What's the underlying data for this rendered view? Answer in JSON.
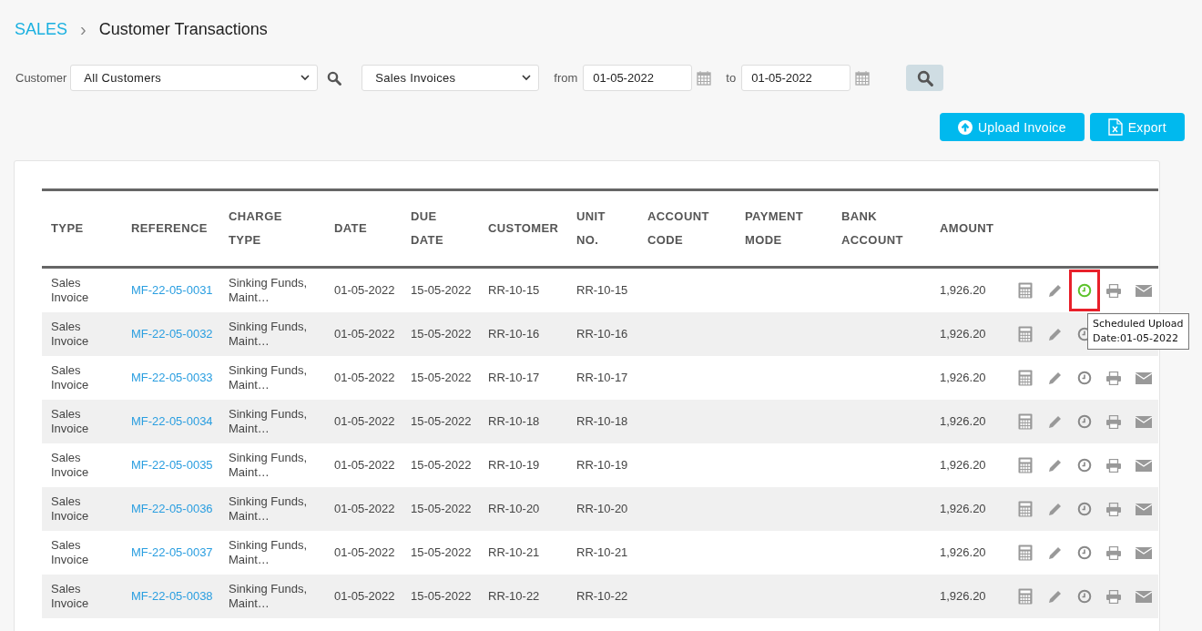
{
  "breadcrumb": {
    "section": "SALES",
    "separator": "›",
    "page": "Customer Transactions"
  },
  "filters": {
    "customer_label": "Customer",
    "customer": "All Customers",
    "doc_type": "Sales Invoices",
    "from_label": "from",
    "from": "01-05-2022",
    "to_label": "to",
    "to": "01-05-2022"
  },
  "buttons": [
    {
      "label": "Upload Invoice",
      "kind": "upload"
    },
    {
      "label": "Export",
      "kind": "export"
    }
  ],
  "table": {
    "columns": [
      [
        "TYPE"
      ],
      [
        "REFERENCE"
      ],
      [
        "CHARGE",
        "TYPE"
      ],
      [
        "DATE"
      ],
      [
        "DUE",
        "DATE"
      ],
      [
        "CUSTOMER"
      ],
      [
        "UNIT",
        "NO."
      ],
      [
        "ACCOUNT",
        "CODE"
      ],
      [
        "PAYMENT",
        "MODE"
      ],
      [
        "BANK",
        "ACCOUNT"
      ],
      [
        "AMOUNT"
      ]
    ],
    "rows": [
      {
        "type": [
          "Sales",
          "Invoice"
        ],
        "reference": "MF-22-05-0031",
        "charge": [
          "Sinking Funds,",
          "Maint…"
        ],
        "date": "01-05-2022",
        "due": "15-05-2022",
        "customer": "RR-10-15",
        "unit": "RR-10-15",
        "amount": "1,926.20",
        "scheduled": true,
        "highlighted": true,
        "tooltip": [
          "Scheduled Upload",
          "Date:01-05-2022"
        ]
      },
      {
        "type": [
          "Sales",
          "Invoice"
        ],
        "reference": "MF-22-05-0032",
        "charge": [
          "Sinking Funds,",
          "Maint…"
        ],
        "date": "01-05-2022",
        "due": "15-05-2022",
        "customer": "RR-10-16",
        "unit": "RR-10-16",
        "amount": "1,926.20",
        "scheduled": false,
        "highlighted": false
      },
      {
        "type": [
          "Sales",
          "Invoice"
        ],
        "reference": "MF-22-05-0033",
        "charge": [
          "Sinking Funds,",
          "Maint…"
        ],
        "date": "01-05-2022",
        "due": "15-05-2022",
        "customer": "RR-10-17",
        "unit": "RR-10-17",
        "amount": "1,926.20",
        "scheduled": false,
        "highlighted": false
      },
      {
        "type": [
          "Sales",
          "Invoice"
        ],
        "reference": "MF-22-05-0034",
        "charge": [
          "Sinking Funds,",
          "Maint…"
        ],
        "date": "01-05-2022",
        "due": "15-05-2022",
        "customer": "RR-10-18",
        "unit": "RR-10-18",
        "amount": "1,926.20",
        "scheduled": false,
        "highlighted": false
      },
      {
        "type": [
          "Sales",
          "Invoice"
        ],
        "reference": "MF-22-05-0035",
        "charge": [
          "Sinking Funds,",
          "Maint…"
        ],
        "date": "01-05-2022",
        "due": "15-05-2022",
        "customer": "RR-10-19",
        "unit": "RR-10-19",
        "amount": "1,926.20",
        "scheduled": false,
        "highlighted": false
      },
      {
        "type": [
          "Sales",
          "Invoice"
        ],
        "reference": "MF-22-05-0036",
        "charge": [
          "Sinking Funds,",
          "Maint…"
        ],
        "date": "01-05-2022",
        "due": "15-05-2022",
        "customer": "RR-10-20",
        "unit": "RR-10-20",
        "amount": "1,926.20",
        "scheduled": false,
        "highlighted": false
      },
      {
        "type": [
          "Sales",
          "Invoice"
        ],
        "reference": "MF-22-05-0037",
        "charge": [
          "Sinking Funds,",
          "Maint…"
        ],
        "date": "01-05-2022",
        "due": "15-05-2022",
        "customer": "RR-10-21",
        "unit": "RR-10-21",
        "amount": "1,926.20",
        "scheduled": false,
        "highlighted": false
      },
      {
        "type": [
          "Sales",
          "Invoice"
        ],
        "reference": "MF-22-05-0038",
        "charge": [
          "Sinking Funds,",
          "Maint…"
        ],
        "date": "01-05-2022",
        "due": "15-05-2022",
        "customer": "RR-10-22",
        "unit": "RR-10-22",
        "amount": "1,926.20",
        "scheduled": false,
        "highlighted": false
      }
    ]
  }
}
